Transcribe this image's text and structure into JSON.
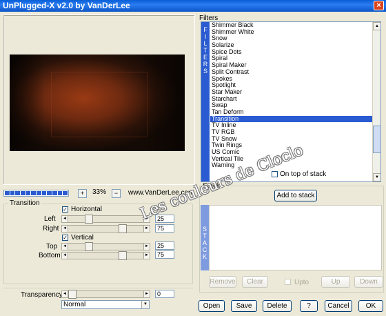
{
  "window": {
    "title": "UnPlugged-X v2.0 by VanDerLee",
    "close_glyph": "×"
  },
  "preview": {
    "progress_segments": 12,
    "progress_fraction": 1.0,
    "zoom": "33%",
    "zoom_minus": "−",
    "zoom_plus": "+",
    "site": "www.VanDerLee.com"
  },
  "transition": {
    "caption": "Transition",
    "horizontal": {
      "label": "Horizontal",
      "checked": true,
      "check_glyph": "✓"
    },
    "vertical": {
      "label": "Vertical",
      "checked": true,
      "check_glyph": "✓"
    },
    "left": {
      "label": "Left",
      "value": "25",
      "level": 0.25
    },
    "right": {
      "label": "Right",
      "value": "75",
      "level": 0.75
    },
    "top": {
      "label": "Top",
      "value": "25",
      "level": 0.25
    },
    "bottom": {
      "label": "Bottom",
      "value": "75",
      "level": 0.75
    },
    "arrow_left": "◄",
    "arrow_right": "►"
  },
  "transparency": {
    "label": "Transparency",
    "value": "0",
    "level": 0.0
  },
  "blend_mode": {
    "selected": "Normal",
    "dd_glyph": "▼"
  },
  "filters": {
    "caption": "Filters",
    "tab_letters": [
      "F",
      "I",
      "L",
      "T",
      "E",
      "R",
      "S"
    ],
    "items": [
      "Shimmer Black",
      "Shimmer White",
      "Snow",
      "Solarize",
      "Spice Dots",
      "Spiral",
      "Spiral Maker",
      "Split Contrast",
      "Spokes",
      "Spotlight",
      "Star Maker",
      "Starchart",
      "Swap",
      "Tan Deform",
      "Transition",
      "TV Inline",
      "TV RGB",
      "TV Snow",
      "Twin Rings",
      "US Comic",
      "Vertical Tile",
      "Warning"
    ],
    "selected": "Transition",
    "scroll_up": "▲",
    "scroll_down": "▼"
  },
  "on_top_of_stack": {
    "label": "On top of stack",
    "checked": false
  },
  "stack": {
    "caption": "Stack",
    "add_button": "Add to stack",
    "tab_letters": [
      "S",
      "T",
      "A",
      "C",
      "K"
    ],
    "remove": "Remove",
    "clear": "Clear",
    "upto": "Upto",
    "up": "Up",
    "down": "Down"
  },
  "footer": {
    "open": "Open",
    "save": "Save",
    "delete": "Delete",
    "help": "?",
    "cancel": "Cancel",
    "ok": "OK"
  },
  "watermark": "Les couleurs de Cloclo",
  "colors": {
    "title_blue": "#0a5fd8",
    "selection_blue": "#2a5bd0",
    "dialog_bg": "#ece9d8"
  }
}
